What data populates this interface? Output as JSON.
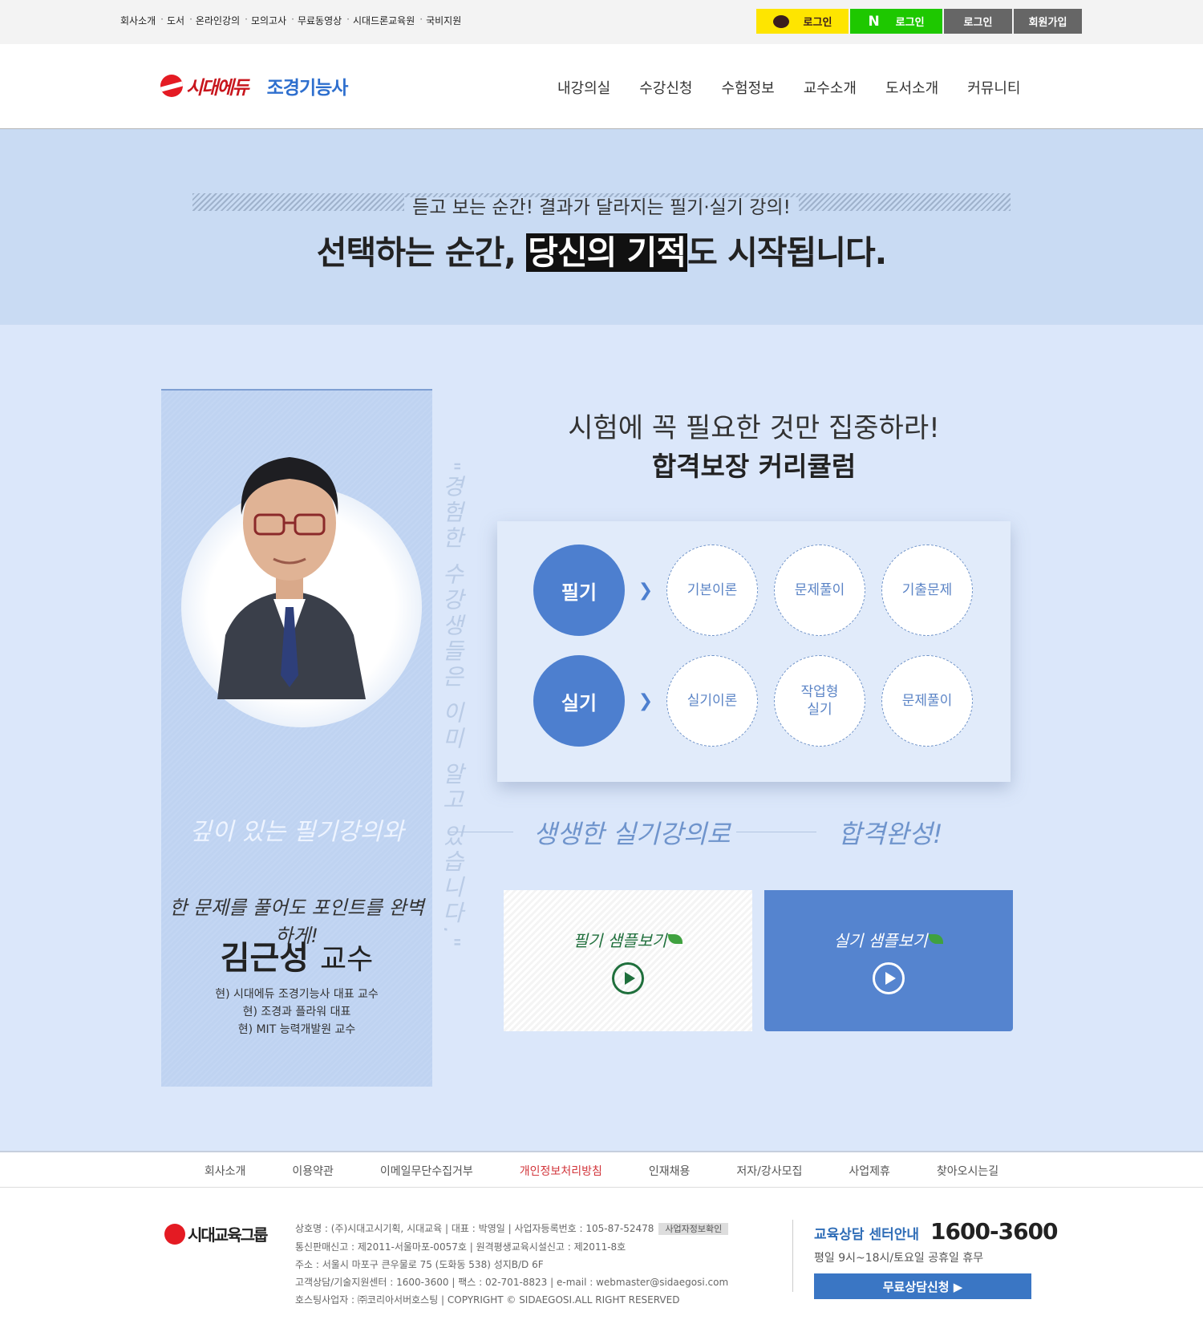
{
  "topbar": {
    "links": [
      "회사소개",
      "도서",
      "온라인강의",
      "모의고사",
      "무료동영상",
      "시대드론교육원",
      "국비지원"
    ],
    "kakao_login": "로그인",
    "naver_login": "로그인",
    "login": "로그인",
    "signup": "회원가입"
  },
  "header": {
    "logo": "시대에듀",
    "subtitle": "조경기능사",
    "nav": [
      "내강의실",
      "수강신청",
      "수험정보",
      "교수소개",
      "도서소개",
      "커뮤니티"
    ]
  },
  "banner": {
    "subtitle": "듣고 보는 순간! 결과가 달라지는 필기·실기 강의!",
    "title_prefix": "선택하는 순간, ",
    "title_highlight": "당신의 기적",
    "title_suffix": "도 시작됩니다."
  },
  "professor": {
    "script1": "깊이 있는 필기강의와",
    "script2": "한 문제를 풀어도 포인트를 완벽하게!",
    "name": "김근성",
    "title": "교수",
    "desc": [
      "현) 시대에듀 조경기능사 대표 교수",
      "현) 조경과 플라워 대표",
      "현) MIT 능력개발원 교수"
    ],
    "quote": "\"경험한 수강생들은 이미 알고 있습니다.\""
  },
  "curriculum": {
    "title_line1": "시험에 꼭 필요한 것만 집중하라!",
    "title_line2": "합격보장 커리큘럼",
    "rows": [
      {
        "label": "필기",
        "items": [
          "기본이론",
          "문제풀이",
          "기출문제"
        ]
      },
      {
        "label": "실기",
        "items": [
          "실기이론",
          "작업형\n실기",
          "문제풀이"
        ]
      }
    ]
  },
  "handwriting": {
    "middle": "생생한 실기강의로",
    "right": "합격완성!"
  },
  "samples": {
    "written": "필기 샘플보기",
    "practical": "실기 샘플보기"
  },
  "footer_nav": [
    "회사소개",
    "이용약관",
    "이메일무단수집거부",
    "개인정보처리방침",
    "인재채용",
    "저자/강사모집",
    "사업제휴",
    "찾아오시는길"
  ],
  "footer": {
    "logo": "시대교육그룹",
    "info": [
      "상호명 : (주)시대고시기획, 시대교육 | 대표 : 박영일 | 사업자등록번호 : 105-87-52478",
      "통신판매신고 : 제2011-서울마포-0057호 | 원격평생교육시설신고 : 제2011-8호",
      "주소 : 서울시 마포구 큰우물로 75 (도화동 538) 성지B/D 6F",
      "고객상담/기술지원센터 : 1600-3600 | 팩스 : 02-701-8823 | e-mail : webmaster@sidaegosi.com",
      "호스팅사업자 : ㈜코리아서버호스팅 | COPYRIGHT © SIDAEGOSI.ALL RIGHT RESERVED"
    ],
    "badge": "사업자정보확인",
    "cs_label": "교육상담 센터안내",
    "cs_number": "1600-3600",
    "cs_hours": "평일 9시~18시/토요일 공휴일 휴무",
    "cs_button": "무료상담신청 ▶"
  }
}
